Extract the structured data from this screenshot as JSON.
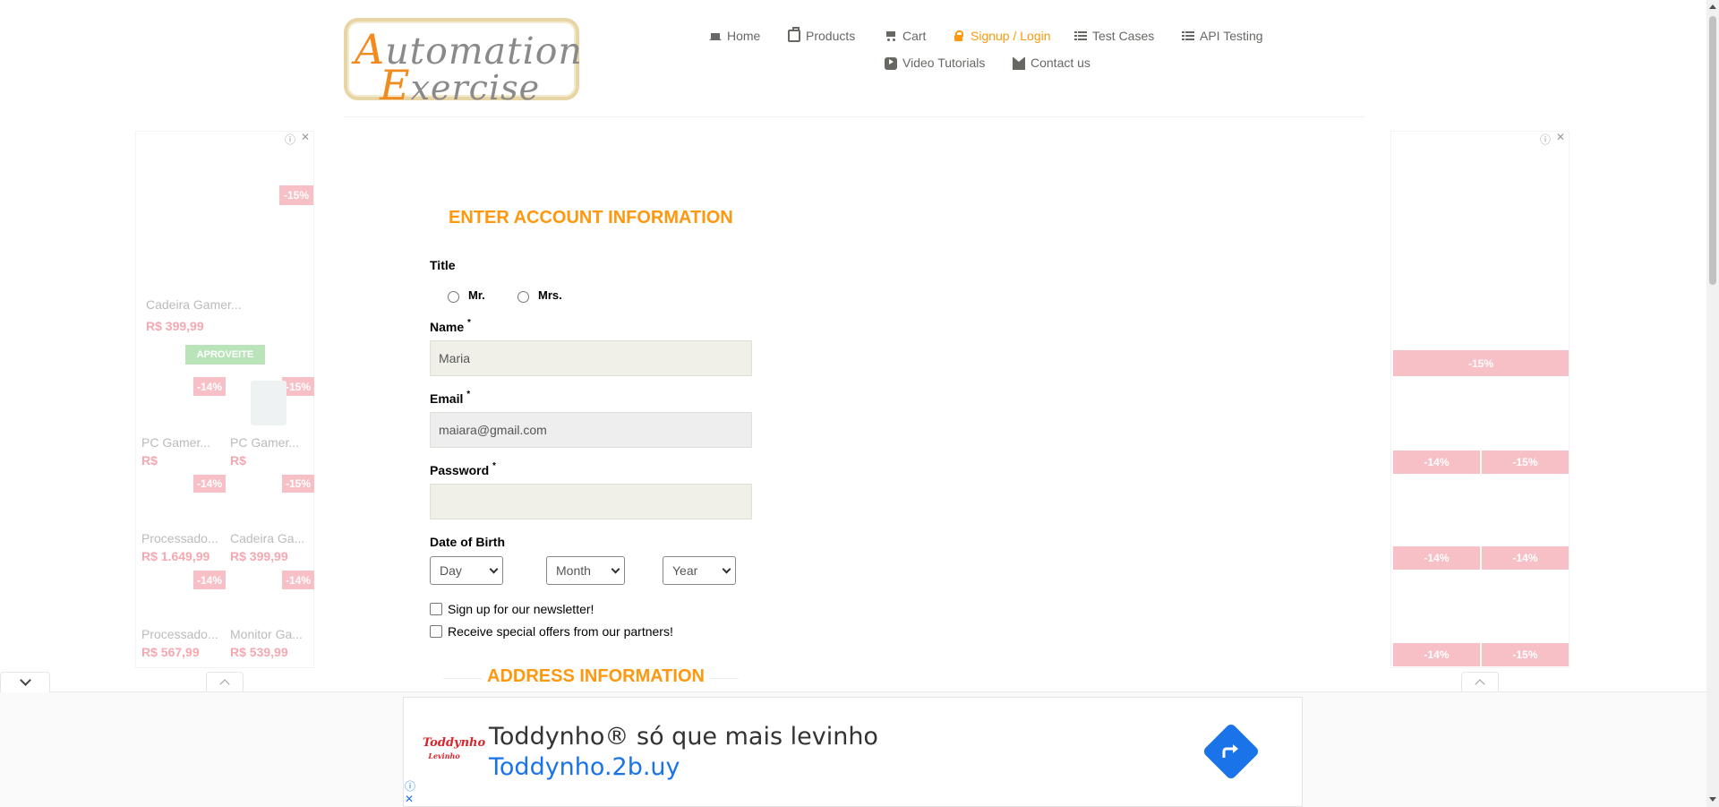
{
  "header": {
    "logo_line1": "Automation",
    "logo_line2": "Exercise",
    "nav": [
      {
        "label": "Home",
        "icon": "home-icon"
      },
      {
        "label": "Products",
        "icon": "shopping-bag-icon"
      },
      {
        "label": "Cart",
        "icon": "cart-icon"
      },
      {
        "label": "Signup / Login",
        "icon": "lock-icon",
        "active": true
      },
      {
        "label": "Test Cases",
        "icon": "list-icon"
      },
      {
        "label": "API Testing",
        "icon": "list-icon"
      },
      {
        "label": "Video Tutorials",
        "icon": "youtube-icon"
      },
      {
        "label": "Contact us",
        "icon": "envelope-icon"
      }
    ]
  },
  "form": {
    "heading": "ENTER ACCOUNT INFORMATION",
    "title_label": "Title",
    "title_options": [
      "Mr.",
      "Mrs."
    ],
    "name_label": "Name",
    "name_value": "Maria",
    "email_label": "Email",
    "email_value": "maiara@gmail.com",
    "password_label": "Password",
    "password_value": "",
    "required_mark": "*",
    "dob_label": "Date of Birth",
    "day": "Day",
    "month": "Month",
    "year": "Year",
    "newsletter_label": "Sign up for our newsletter!",
    "offers_label": "Receive special offers from our partners!",
    "address_heading": "ADDRESS INFORMATION"
  },
  "left_ad": {
    "badges": [
      "-15%",
      "-14%",
      "-15%",
      "-14%",
      "-15%",
      "-14%",
      "-14%"
    ],
    "products": [
      {
        "title": "Cadeira Gamer...",
        "price": "R$ 399,99"
      },
      {
        "title": "PC Gamer...",
        "price": "R$"
      },
      {
        "title": "PC Gamer...",
        "price": "R$"
      },
      {
        "title": "Processado...",
        "price": "R$ 1.649,99"
      },
      {
        "title": "Cadeira Ga...",
        "price": "R$ 399,99"
      },
      {
        "title": "Processado...",
        "price": "R$ 567,99"
      },
      {
        "title": "Monitor Ga...",
        "price": "R$ 539,99"
      }
    ],
    "cta": "APROVEITE"
  },
  "right_ad": {
    "badges": [
      "-15%",
      "-14%",
      "-15%",
      "-14%",
      "-14%",
      "-14%",
      "-15%"
    ]
  },
  "bottom_ad": {
    "brand": "Toddynho",
    "title": "Toddynho® só que mais levinho",
    "url": "Toddynho.2b.uy"
  },
  "colors": {
    "accent": "#fe980f",
    "nav_text": "#696763",
    "badge": "#f6c0c6",
    "link_blue": "#1a73e8"
  }
}
